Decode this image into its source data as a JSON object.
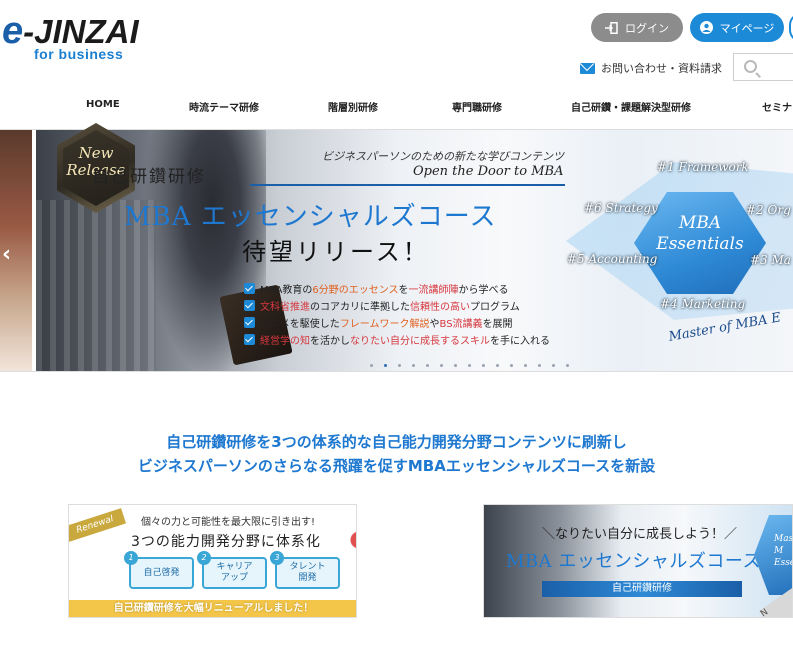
{
  "header": {
    "logo_main": "-JINZAI",
    "logo_e": "e",
    "logo_sub": "for business",
    "login_label": "ログイン",
    "mypage_label": "マイページ",
    "contact_label": "お問い合わせ・資料請求",
    "search_placeholder": ""
  },
  "nav": {
    "items": [
      {
        "label": "HOME"
      },
      {
        "label": "時流テーマ研修"
      },
      {
        "label": "階層別研修"
      },
      {
        "label": "専門職研修"
      },
      {
        "label": "自己研鑽・課題解決型研修"
      },
      {
        "label": "セミナ"
      }
    ]
  },
  "hero": {
    "kicker": "自己研鑽研修",
    "tagline_jp": "ビジネスパーソンのための新たな学びコンテンツ",
    "tagline_en": "Open the Door to MBA",
    "title": "MBA エッセンシャルズコース",
    "subtitle": "待望リリース！",
    "badge_line1": "New",
    "badge_line2": "Release",
    "bullets": [
      {
        "pre": "MBA教育の",
        "hl": "6分野のエッセンス",
        "mid": "を",
        "hl2": "一流講師陣",
        "post": "から学べる"
      },
      {
        "pre": "",
        "hl": "文科省推進",
        "mid": "のコアカリに準拠した",
        "hl2": "信頼性の高い",
        "post": "プログラム"
      },
      {
        "pre": "アニメを駆使した",
        "hl": "フレームワーク解説",
        "mid": "や",
        "hl2": "BS流講義",
        "post": "を展開"
      },
      {
        "pre": "",
        "hl": "経営学の知",
        "mid": "を活かし",
        "hl2": "なりたい自分に成長するスキル",
        "post": "を手に入れる"
      }
    ],
    "diamond_line1": "MBA",
    "diamond_line2": "Essentials",
    "frameworks": {
      "f1": "#1 Framework",
      "f2": "#2 Org",
      "f3": "#3 Ma",
      "f4": "#4 Marketing",
      "f5": "#5 Accounting",
      "f6": "#6 Strategy"
    },
    "master": "Master of MBA E",
    "arrow": "‹",
    "active_dot": 1
  },
  "headline": {
    "line1": "自己研鑽研修を3つの体系的な自己能力開発分野コンテンツに刷新し",
    "line2": "ビジネスパーソンのさらなる飛躍を促すMBAエッセンシャルズコースを新設"
  },
  "banner_left": {
    "tag": "Renewal",
    "kicker": "個々の力と可能性を最大限に引き出す!",
    "title": "3つの能力開発分野に体系化",
    "chips": [
      {
        "n": "1",
        "label": "自己啓発"
      },
      {
        "n": "2",
        "label": "キャリア\nアップ"
      },
      {
        "n": "3",
        "label": "タレント\n開発"
      }
    ],
    "footer": "自己研鑽研修を大幅リニューアルしました！"
  },
  "banner_right": {
    "kicker": "＼なりたい自分に成長しよう！／",
    "title": "MBA エッセンシャルズコース",
    "bar": "自己研鑽研修",
    "hex_text": "Mast\nM\nEsse",
    "corner": "N"
  },
  "colors": {
    "accent": "#1e78d0",
    "login": "#8c8c8c",
    "mypage": "#1d8ad8"
  }
}
